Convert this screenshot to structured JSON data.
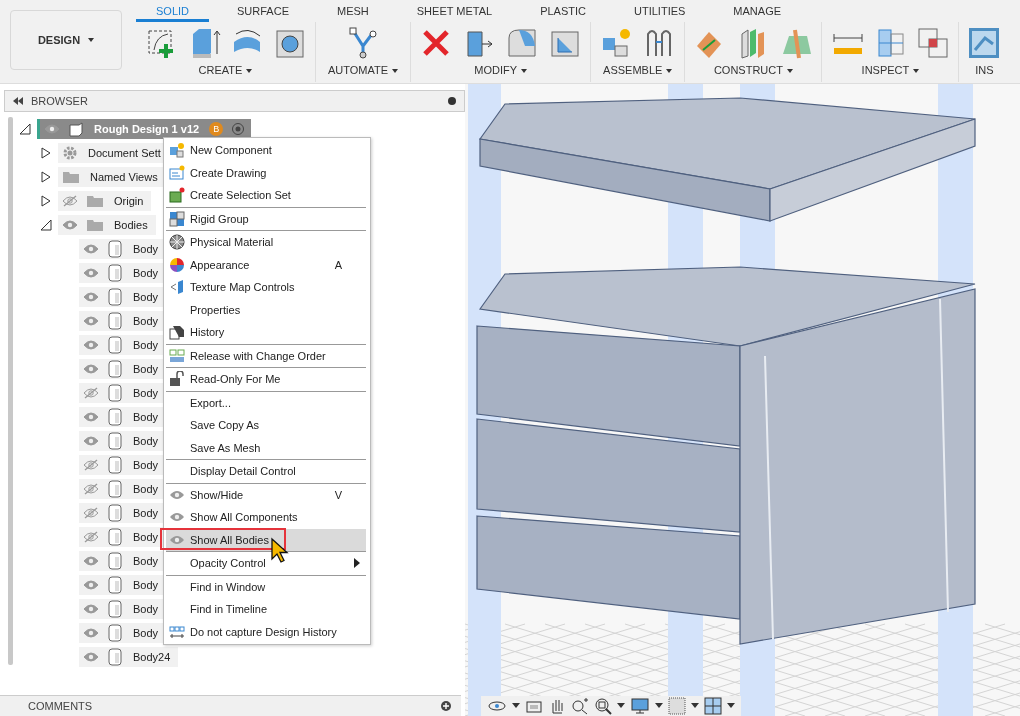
{
  "workspace": {
    "label": "DESIGN"
  },
  "tabs": [
    {
      "label": "SOLID",
      "selected": true
    },
    {
      "label": "SURFACE",
      "selected": false
    },
    {
      "label": "MESH",
      "selected": false
    },
    {
      "label": "SHEET METAL",
      "selected": false
    },
    {
      "label": "PLASTIC",
      "selected": false
    },
    {
      "label": "UTILITIES",
      "selected": false
    },
    {
      "label": "MANAGE",
      "selected": false
    }
  ],
  "groups": [
    {
      "label": "CREATE"
    },
    {
      "label": "AUTOMATE"
    },
    {
      "label": "MODIFY"
    },
    {
      "label": "ASSEMBLE"
    },
    {
      "label": "CONSTRUCT"
    },
    {
      "label": "INSPECT"
    },
    {
      "label": "INS"
    }
  ],
  "browser": {
    "title": "BROWSER",
    "tree": [
      {
        "kind": "component",
        "label": "Rough Design 1 v12",
        "badge": "B",
        "expanded": true,
        "visible": true,
        "children": [
          {
            "kind": "settings",
            "label": "Document Sett",
            "expanded": false
          },
          {
            "kind": "folder",
            "label": "Named Views",
            "expanded": false
          },
          {
            "kind": "folder",
            "label": "Origin",
            "expanded": false,
            "visible": false
          },
          {
            "kind": "folder",
            "label": "Bodies",
            "expanded": true,
            "visible": true,
            "children": [
              {
                "kind": "body",
                "label": "Body",
                "visible": true
              },
              {
                "kind": "body",
                "label": "Body",
                "visible": true
              },
              {
                "kind": "body",
                "label": "Body",
                "visible": true
              },
              {
                "kind": "body",
                "label": "Body",
                "visible": true
              },
              {
                "kind": "body",
                "label": "Body",
                "visible": true
              },
              {
                "kind": "body",
                "label": "Body",
                "visible": true
              },
              {
                "kind": "body",
                "label": "Body",
                "visible": false
              },
              {
                "kind": "body",
                "label": "Body",
                "visible": true
              },
              {
                "kind": "body",
                "label": "Body",
                "visible": true
              },
              {
                "kind": "body",
                "label": "Body",
                "visible": false
              },
              {
                "kind": "body",
                "label": "Body",
                "visible": false
              },
              {
                "kind": "body",
                "label": "Body",
                "visible": false
              },
              {
                "kind": "body",
                "label": "Body",
                "visible": false
              },
              {
                "kind": "body",
                "label": "Body",
                "visible": true
              },
              {
                "kind": "body",
                "label": "Body",
                "visible": true
              },
              {
                "kind": "body",
                "label": "Body",
                "visible": true
              },
              {
                "kind": "body",
                "label": "Body",
                "visible": true
              },
              {
                "kind": "body",
                "label": "Body24",
                "visible": true
              }
            ]
          }
        ]
      }
    ]
  },
  "context_menu": {
    "sections": [
      [
        {
          "label": "New Component",
          "selected": false
        },
        {
          "label": "Create Drawing",
          "selected": false
        },
        {
          "label": "Create Selection Set",
          "selected": false
        }
      ],
      [
        {
          "label": "Rigid Group",
          "selected": false
        }
      ],
      [
        {
          "label": "Physical Material",
          "selected": false
        },
        {
          "label": "Appearance",
          "shortcut": "A",
          "selected": false
        },
        {
          "label": "Texture Map Controls",
          "selected": false
        },
        {
          "label": "Properties",
          "selected": false
        },
        {
          "label": "History",
          "selected": false
        }
      ],
      [
        {
          "label": "Release with Change Order",
          "selected": false
        }
      ],
      [
        {
          "label": "Read-Only For Me",
          "selected": false
        }
      ],
      [
        {
          "label": "Export...",
          "selected": false
        },
        {
          "label": "Save Copy As",
          "selected": false
        },
        {
          "label": "Save As Mesh",
          "selected": false
        }
      ],
      [
        {
          "label": "Display Detail Control",
          "selected": false
        }
      ],
      [
        {
          "label": "Show/Hide",
          "shortcut": "V",
          "selected": false
        },
        {
          "label": "Show All Components",
          "selected": false
        },
        {
          "label": "Show All Bodies",
          "selected": true
        }
      ],
      [
        {
          "label": "Opacity Control",
          "submenu": true,
          "selected": false
        }
      ],
      [
        {
          "label": "Find in Window",
          "selected": false
        },
        {
          "label": "Find in Timeline",
          "selected": false
        },
        {
          "label": "Do not capture Design History",
          "selected": false
        }
      ]
    ]
  },
  "comments": {
    "title": "COMMENTS"
  }
}
